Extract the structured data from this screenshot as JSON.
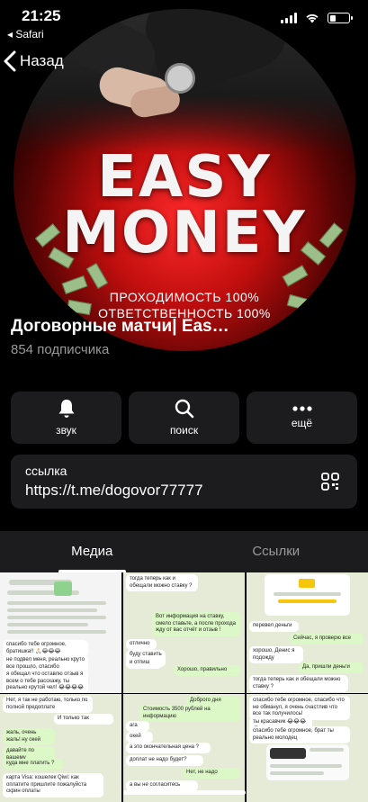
{
  "status_bar": {
    "time": "21:25",
    "back_app": "◂ Safari",
    "battery_level": 0.3
  },
  "nav": {
    "back_label": "Назад"
  },
  "avatar": {
    "line1": "EASY",
    "line2": "MONEY",
    "sub1": "ПРОХОДИМОСТЬ 100%",
    "sub2": "ОТВЕТСТВЕННОСТЬ 100%"
  },
  "channel": {
    "name": "Договорные матчи| Eas…",
    "subscribers": "854 подписчика"
  },
  "actions": [
    {
      "label": "звук",
      "icon": "bell-icon"
    },
    {
      "label": "поиск",
      "icon": "search-icon"
    },
    {
      "label": "ещё",
      "icon": "more-icon"
    }
  ],
  "link": {
    "title": "ссылка",
    "url": "https://t.me/dogovor77777",
    "icon": "qr-code-icon"
  },
  "tabs": [
    {
      "label": "Медиа",
      "active": true
    },
    {
      "label": "Ссылки",
      "active": false
    }
  ],
  "media": {
    "thumb1": {
      "msg1": "спасибо тебе огромное, братишка!! 🙏🏻😂😂😂",
      "msg2": "не подвел меня, реально круто все прошло, спасибо",
      "msg3": "я обещал что оставлю отзыв я всем о тебе расскажу, ты реально крутой чел! 😂😂😂😂"
    },
    "thumb2": {
      "msg1": "тогда теперь как и обещали можно ставку ?",
      "msg2": "Вот информация на ставку, смело ставьте, а после прохода жду от вас отчёт и отзыв !",
      "msg3": "отлично",
      "msg4": "буду ставить )",
      "msg5": "и отпиш",
      "msg6": "Хорошо, правильно"
    },
    "thumb3": {
      "msg1": "перевел деньги",
      "msg2": "Сейчас, я проверю все",
      "msg3": "хорошо, Денис я подожду",
      "msg4": "Да, пришли деньги",
      "msg5": "тогда теперь как и обещали можно ставку ?"
    },
    "thumb4": {
      "msg1": "Нет, я так не работаю, только по полной предоплате",
      "msg2": "И только так",
      "msg3": "жаль, очень жаль! ну окей",
      "msg4": "давайте по вашему",
      "msg5": "куда мне платить ?",
      "msg6": "карта Visa: кошелек Qiwi: как оплатите пришлите пожалуйста скрин оплаты"
    },
    "thumb5": {
      "msg1": "Доброго дня",
      "msg2": "Стоимость 3500 рублей на информацию",
      "msg3": "ага",
      "msg4": "окей",
      "msg5": "а это окончательная цена ?",
      "msg6": "доплат не надо будет?",
      "msg7": "Нет, не надо",
      "msg8": "а вы не согласитесь"
    },
    "thumb6": {
      "msg1": "спасибо тебе огромное, спасибо что не обманул, я очень счастлив что все так получилось!",
      "msg2": "ты красавчик 😂😂😂😂",
      "msg3": "спасибо тебе огромное, брат ты реально молодец"
    }
  }
}
